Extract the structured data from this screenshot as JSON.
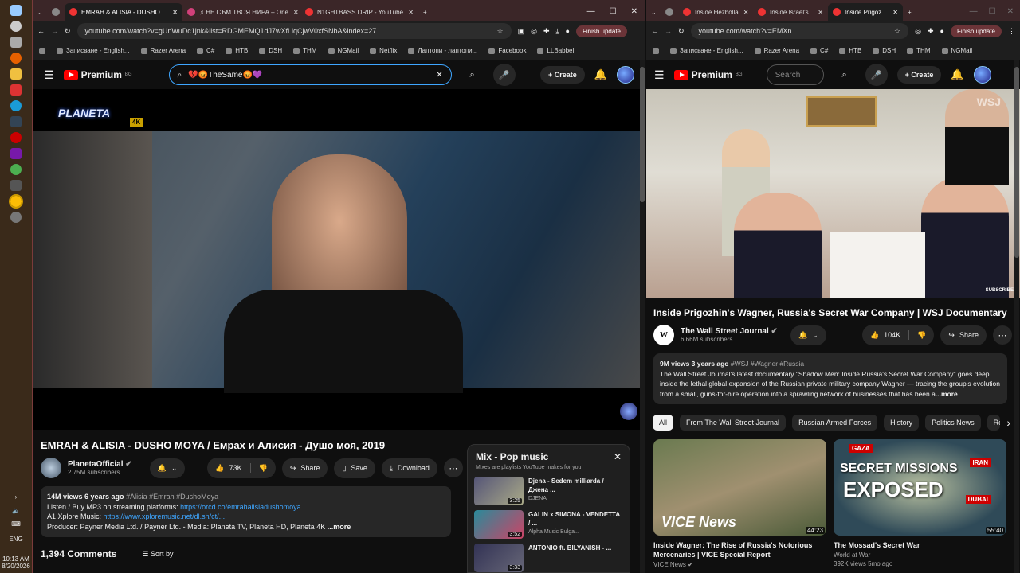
{
  "taskbar": {
    "time": "10:13 AM",
    "date": "8/20/2026",
    "lang": "ENG"
  },
  "left": {
    "tabs": [
      "EMRAH & ALISIA - DUSHO",
      "♫ НЕ СЪМ ТВОЯ НИРА – Orie",
      "N1GHTBASS DRIP - YouTube"
    ],
    "url": "youtube.com/watch?v=gUnWuDc1jnk&list=RDGMEMQ1dJ7wXfLlqCjwV0xfSNbA&index=27",
    "update": "Finish update",
    "bookmarks": [
      "Записване - English...",
      "Razer Arena",
      "C#",
      "HTB",
      "DSH",
      "THM",
      "NGMail",
      "Netflix",
      "Лаптопи - лаптопи...",
      "Facebook",
      "LLBabbel"
    ],
    "logo": "Premium",
    "region": "BG",
    "search": "💔😡TheSame😡💜",
    "create": "Create",
    "watermark": "PLANETA",
    "hd": "4K",
    "title": "EMRAH & ALISIA - DUSHO MOYA / Емрах и Алисия - Душо моя, 2019",
    "channel": "PlanetaOfficial",
    "subs": "2.75M subscribers",
    "likes": "73K",
    "share": "Share",
    "save": "Save",
    "download": "Download",
    "desc_meta": "14M views  6 years ago",
    "desc_tags": "#Alisia #Emrah #DushoMoya",
    "desc_l1": "Listen / Buy MP3 on streaming platforms: ",
    "desc_l1_link": "https://orcd.co/emrahalisiadushomoya",
    "desc_l2": "A1 Xplore Music: ",
    "desc_l2_link": "https://www.xploremusic.net/dl.sh/ct/...",
    "desc_l3": "Producer: Payner Media Ltd. / Payner Ltd. - Media: Planeta TV, Planeta HD, Planeta 4K",
    "more": "...more",
    "comments": "1,394 Comments",
    "sort": "Sort by",
    "mix": {
      "title": "Mix - Pop music",
      "sub": "Mixes are playlists YouTube makes for you",
      "items": [
        {
          "title": "Djena - Sedem milliarda / Джена ...",
          "ch": "DJENA",
          "dur": "3:25"
        },
        {
          "title": "GALIN x SIMONA - VENDETTA / ...",
          "ch": "Alpha Music Bulga...",
          "dur": "3:52"
        },
        {
          "title": "ANTONIO ft. BILYANISH - ...",
          "ch": "",
          "dur": "3:33"
        }
      ]
    }
  },
  "right": {
    "tabs": [
      "Inside Hezbolla",
      "Inside Israel's",
      "Inside Prigoz"
    ],
    "url": "youtube.com/watch?v=EMXn...",
    "update": "Finish update",
    "bookmarks": [
      "Записване - English...",
      "Razer Arena",
      "C#",
      "HTB",
      "DSH",
      "THM",
      "NGMail"
    ],
    "logo": "Premium",
    "region": "BG",
    "search_ph": "Search",
    "create": "Create",
    "subscribe_wm": "SUBSCRIBE",
    "wsj_wm": "WSJ",
    "title": "Inside Prigozhin's Wagner, Russia's Secret War Company | WSJ Documentary",
    "channel": "The Wall Street Journal",
    "subs": "6.66M subscribers",
    "likes": "104K",
    "share": "Share",
    "desc_meta": "9M views  3 years ago",
    "desc_tags": "#WSJ #Wagner #Russia",
    "desc_text": "The Wall Street Journal's latest documentary \"Shadow Men: Inside Russia's Secret War Company\" goes deep inside the lethal global expansion of the Russian private military company Wagner — tracing the group's evolution from a small, guns-for-hire operation into a sprawling network of businesses that has been a",
    "more": "...more",
    "chips": [
      "All",
      "From The Wall Street Journal",
      "Russian Armed Forces",
      "History",
      "Politics News",
      "Re"
    ],
    "recs": [
      {
        "title": "Inside Wagner: The Rise of Russia's Notorious Mercenaries | VICE Special Report",
        "ch": "VICE News",
        "dur": "44:23",
        "overlay": "VICE News"
      },
      {
        "title": "The Mossad's Secret War",
        "ch": "World at War",
        "meta": "392K views  5mo ago",
        "dur": "55:40",
        "overlay1": "SECRET MISSIONS",
        "overlay2": "EXPOSED",
        "tag1": "GAZA",
        "tag2": "IRAN",
        "tag3": "DUBAI"
      }
    ]
  }
}
